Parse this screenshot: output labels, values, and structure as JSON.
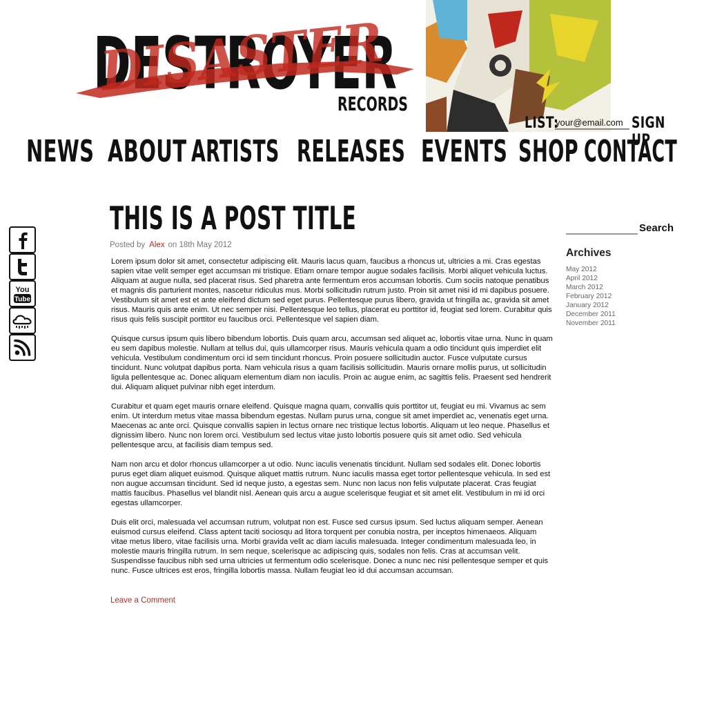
{
  "header": {
    "logo_text": "DESTROYER",
    "logo_scrawl": "DISASTER",
    "logo_sub": "RECORDS",
    "mailing_list": {
      "label": "LIST:",
      "email_value": "your@email.com",
      "signup_label": "SIGN UP"
    }
  },
  "nav": {
    "items": [
      "NEWS",
      "ABOUT",
      "ARTISTS",
      "RELEASES",
      "EVENTS",
      "SHOP",
      "CONTACT"
    ]
  },
  "social": {
    "icons": [
      "facebook-icon",
      "twitter-icon",
      "youtube-icon",
      "soundcloud-icon",
      "rss-icon"
    ],
    "youtube_text": [
      "You",
      "Tube"
    ]
  },
  "post": {
    "title": "THIS IS A POST TITLE",
    "meta_prefix": "Posted by",
    "author": "Alex",
    "meta_date": "on 18th May 2012",
    "paragraphs": [
      "Lorem ipsum dolor sit amet, consectetur adipiscing elit. Mauris lacus quam, faucibus a rhoncus ut, ultricies a mi. Cras egestas sapien vitae velit semper eget accumsan mi tristique. Etiam ornare tempor augue sodales facilisis. Morbi aliquet vehicula luctus. Aliquam at augue nulla, sed placerat risus. Sed pharetra ante fermentum eros accumsan lobortis. Cum sociis natoque penatibus et magnis dis parturient montes, nascetur ridiculus mus. Morbi sollicitudin rutrum justo. Proin sit amet nisi id mi dapibus posuere. Vestibulum sit amet est et ante eleifend dictum sed eget purus. Pellentesque purus libero, gravida ut fringilla ac, gravida sit amet risus. Mauris quis ante enim. Ut nec semper nisi. Pellentesque leo tellus, placerat eu porttitor id, feugiat sed lorem. Curabitur quis risus quis felis suscipit porttitor eu faucibus orci. Pellentesque vel sapien diam.",
      "Quisque cursus ipsum quis libero bibendum lobortis. Duis quam arcu, accumsan sed aliquet ac, lobortis vitae urna. Nunc in quam eu sem dapibus molestie. Nullam at tellus dui, quis ullamcorper risus. Mauris vehicula quam a odio tincidunt quis imperdiet elit vehicula. Vestibulum condimentum orci id sem tincidunt rhoncus. Proin posuere sollicitudin auctor. Fusce vulputate cursus tincidunt. Nunc volutpat dapibus porta. Nam vehicula risus a quam facilisis sollicitudin. Mauris ornare mollis purus, ut sollicitudin ligula pellentesque ac. Donec aliquam elementum diam non iaculis. Proin ac augue enim, ac sagittis felis. Praesent sed hendrerit dui. Aliquam aliquet pulvinar nibh eget interdum.",
      "Curabitur et quam eget mauris ornare eleifend. Quisque magna quam, convallis quis porttitor ut, feugiat eu mi. Vivamus ac sem enim. Ut interdum metus vitae massa bibendum egestas. Nullam purus urna, congue sit amet imperdiet ac, venenatis eget urna. Maecenas ac ante orci. Quisque convallis sapien in lectus ornare nec tristique lectus lobortis. Aliquam ut leo neque. Phasellus et dignissim libero. Nunc non lorem orci. Vestibulum sed lectus vitae justo lobortis posuere quis sit amet odio. Sed vehicula pellentesque arcu, at facilisis diam tempus sed.",
      "Nam non arcu et dolor rhoncus ullamcorper a ut odio. Nunc iaculis venenatis tincidunt. Nullam sed sodales elit. Donec lobortis purus eget diam aliquet euismod. Quisque aliquet mattis rutrum. Nunc iaculis massa eget tortor pellentesque vehicula. In sed est non augue accumsan tincidunt. Sed id neque justo, a egestas sem. Nunc non lacus non felis vulputate placerat. Cras feugiat mattis faucibus. Phasellus vel blandit nisl. Aenean quis arcu a augue scelerisque feugiat et sit amet elit. Vestibulum in mi id orci egestas ullamcorper.",
      "Duis elit orci, malesuada vel accumsan rutrum, volutpat non est. Fusce sed cursus ipsum. Sed luctus aliquam semper. Aenean euismod cursus eleifend. Class aptent taciti sociosqu ad litora torquent per conubia nostra, per inceptos himenaeos. Aliquam vitae metus libero, vitae facilisis urna. Morbi gravida velit ac diam iaculis malesuada. Integer condimentum malesuada leo, in molestie mauris fringilla rutrum. In sem neque, scelerisque ac adipiscing quis, sodales non felis. Cras at accumsan velit. Suspendisse faucibus nibh sed urna ultricies ut fermentum odio scelerisque. Donec a nunc nec nisi pellentesque semper et quis nunc. Fusce ultrices est eros, fringilla lobortis massa. Nullam feugiat leo id dui accumsan accumsan."
    ],
    "leave_comment": "Leave a Comment"
  },
  "sidebar": {
    "search_label": "Search",
    "archives_heading": "Archives",
    "archives": [
      "May 2012",
      "April 2012",
      "March 2012",
      "February 2012",
      "January 2012",
      "December 2011",
      "November 2011"
    ]
  },
  "colors": {
    "accent_red": "#c0281e",
    "text_dark": "#111111",
    "meta_gray": "#777777"
  }
}
